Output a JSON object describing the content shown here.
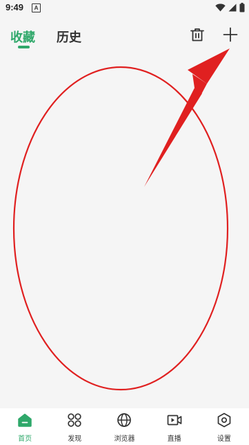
{
  "status_bar": {
    "time": "9:49",
    "notification_glyph": "A",
    "icons": [
      "wifi-icon",
      "signal-icon",
      "battery-icon"
    ]
  },
  "header": {
    "tabs": [
      {
        "label": "收藏",
        "active": true
      },
      {
        "label": "历史",
        "active": false
      }
    ],
    "actions": [
      "trash-icon",
      "plus-icon"
    ]
  },
  "bottom_nav": {
    "items": [
      {
        "label": "首页",
        "icon": "home-icon",
        "active": true
      },
      {
        "label": "发现",
        "icon": "discover-grid-icon",
        "active": false
      },
      {
        "label": "浏览器",
        "icon": "globe-icon",
        "active": false
      },
      {
        "label": "直播",
        "icon": "live-video-icon",
        "active": false
      },
      {
        "label": "设置",
        "icon": "settings-hex-icon",
        "active": false
      }
    ]
  },
  "colors": {
    "accent": "#2fa86a",
    "annotation": "#e02020",
    "background": "#f5f5f5"
  }
}
